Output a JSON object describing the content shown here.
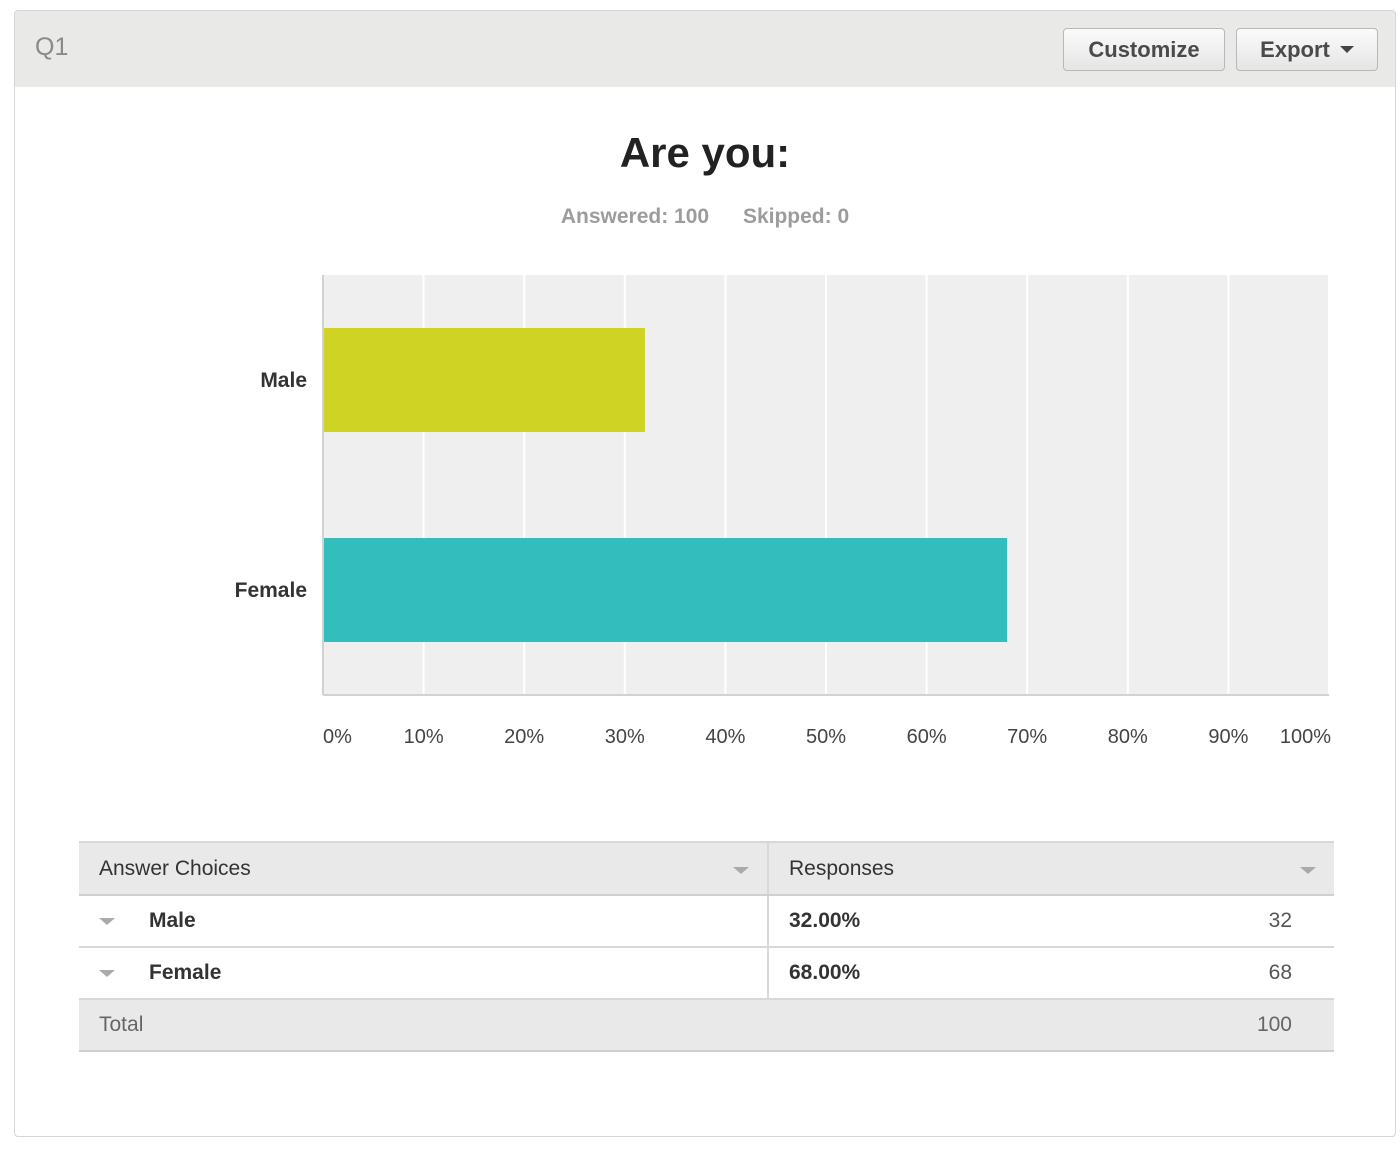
{
  "header": {
    "question_id": "Q1",
    "customize_label": "Customize",
    "export_label": "Export"
  },
  "stats": {
    "answered": "Answered: 100",
    "skipped": "Skipped: 0"
  },
  "chart_data": {
    "type": "bar",
    "orientation": "horizontal",
    "title": "Are you:",
    "categories": [
      "Male",
      "Female"
    ],
    "values": [
      32,
      68
    ],
    "colors": [
      "#cfd424",
      "#34bdbd"
    ],
    "xlim": [
      0,
      100
    ],
    "xticks": [
      "0%",
      "10%",
      "20%",
      "30%",
      "40%",
      "50%",
      "60%",
      "70%",
      "80%",
      "90%",
      "100%"
    ],
    "xlabel": "",
    "ylabel": "",
    "grid": true,
    "plot_background": "#efefef"
  },
  "table": {
    "headers": [
      "Answer Choices",
      "Responses"
    ],
    "rows": [
      {
        "choice": "Male",
        "percent": "32.00%",
        "count": "32"
      },
      {
        "choice": "Female",
        "percent": "68.00%",
        "count": "68"
      }
    ],
    "total_label": "Total",
    "total_count": "100"
  }
}
